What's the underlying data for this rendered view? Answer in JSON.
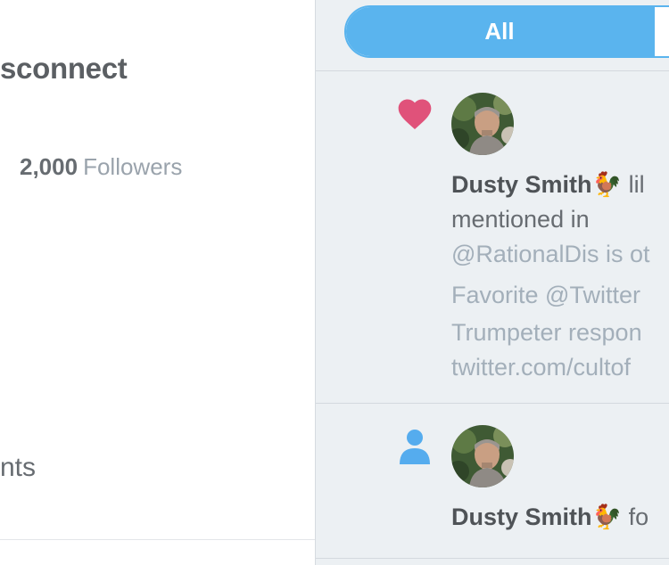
{
  "profile": {
    "name_fragment": "sconnect",
    "followers_count": "2,000",
    "followers_label": "Followers",
    "bottom_fragment": "nts"
  },
  "filter": {
    "all_label": "All"
  },
  "notifications": [
    {
      "type": "like",
      "icon": "heart-icon",
      "icon_color": "#e0527a",
      "user": "Dusty Smith",
      "user_emoji": "🐓",
      "action": " lil",
      "action_line2": "mentioned in",
      "tweet_lines": [
        "@RationalDis is ot",
        "Favorite @Twitter",
        "Trumpeter respon",
        "twitter.com/cultof"
      ]
    },
    {
      "type": "follow",
      "icon": "person-icon",
      "icon_color": "#55acee",
      "user": "Dusty Smith",
      "user_emoji": "🐓",
      "action": " fo"
    }
  ],
  "colors": {
    "accent": "#55acee",
    "like": "#e0527a",
    "panel_bg": "#ecf0f3",
    "text_dark": "#4f5357",
    "text_muted": "#a3afba"
  }
}
